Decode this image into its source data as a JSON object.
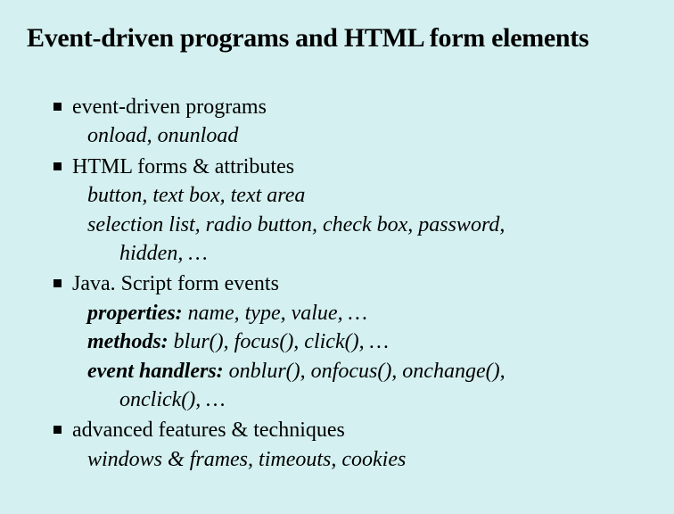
{
  "title": "Event-driven programs and HTML form elements",
  "items": [
    {
      "text": "event-driven programs",
      "subs": [
        {
          "text": "onload, onunload"
        }
      ]
    },
    {
      "text": "HTML forms & attributes",
      "subs": [
        {
          "text": "button, text box, text area"
        },
        {
          "text": "selection list, radio button, check box, password, hidden, …",
          "wrap": true
        }
      ]
    },
    {
      "text": "Java. Script form events",
      "subs": [
        {
          "label": "properties:",
          "text": " name, type, value, …"
        },
        {
          "label": "methods:",
          "text": " blur(), focus(), click(), …"
        },
        {
          "label": "event handlers:",
          "text": " onblur(), onfocus(), onchange(), onclick(), …",
          "wrap": true
        }
      ]
    },
    {
      "text": "advanced features & techniques",
      "subs": [
        {
          "text": "windows & frames, timeouts, cookies"
        }
      ]
    }
  ]
}
